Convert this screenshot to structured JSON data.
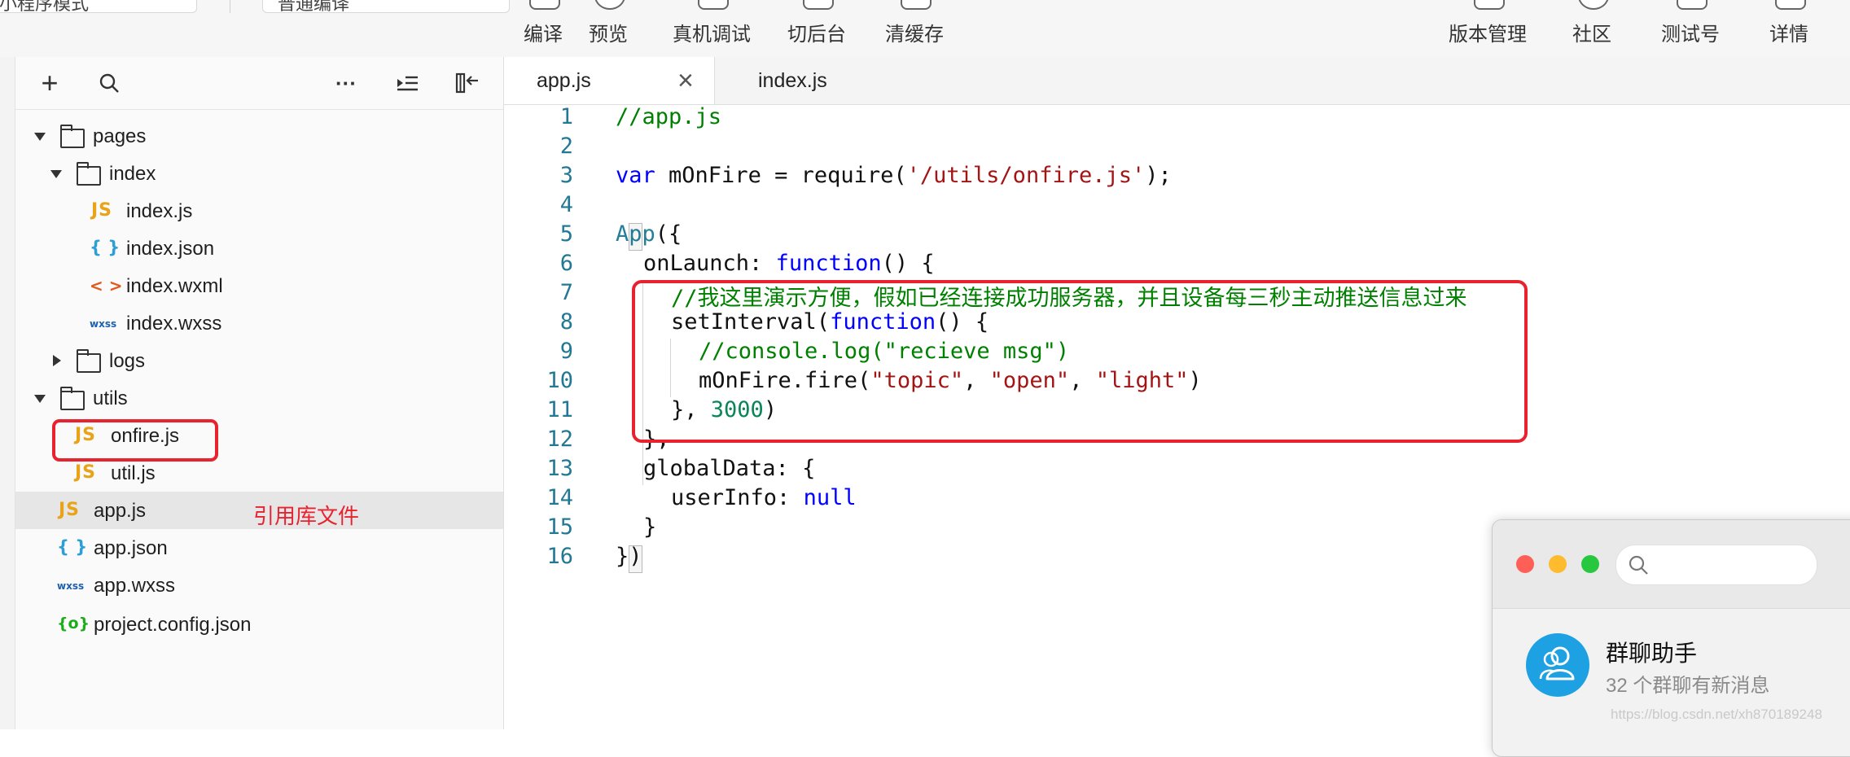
{
  "toolbar": {
    "left_fragment": "小程序模式",
    "mode_fragment": "普通编译",
    "left_actions": [
      "编译",
      "预览",
      "真机调试",
      "切后台",
      "清缓存"
    ],
    "right_actions": [
      "版本管理",
      "社区",
      "测试号",
      "详情"
    ]
  },
  "sidebar": {
    "toolbar_icons": [
      "add-icon",
      "search-icon",
      "more-icon",
      "collapse-all-icon",
      "toggle-panel-icon"
    ],
    "tree": [
      {
        "label": "pages",
        "type": "folder",
        "expanded": true
      },
      {
        "label": "index",
        "type": "folder",
        "expanded": true
      },
      {
        "label": "index.js",
        "type": "js",
        "icon": "JS"
      },
      {
        "label": "index.json",
        "type": "json",
        "icon": "{ }"
      },
      {
        "label": "index.wxml",
        "type": "wxml",
        "icon": "< >"
      },
      {
        "label": "index.wxss",
        "type": "wxss",
        "icon": "wxss"
      },
      {
        "label": "logs",
        "type": "folder",
        "expanded": false
      },
      {
        "label": "utils",
        "type": "folder",
        "expanded": true
      },
      {
        "label": "onfire.js",
        "type": "js",
        "icon": "JS",
        "highlighted": true
      },
      {
        "label": "util.js",
        "type": "js",
        "icon": "JS"
      },
      {
        "label": "app.js",
        "type": "js",
        "icon": "JS",
        "selected": true
      },
      {
        "label": "app.json",
        "type": "json",
        "icon": "{ }"
      },
      {
        "label": "app.wxss",
        "type": "wxss",
        "icon": "wxss"
      },
      {
        "label": "project.config.json",
        "type": "config",
        "icon": "{o}"
      }
    ],
    "annotation": "引用库文件"
  },
  "editor": {
    "tabs": [
      {
        "label": "app.js",
        "active": true,
        "close_glyph": "×"
      },
      {
        "label": "index.js",
        "active": false
      }
    ],
    "line_numbers": [
      "1",
      "2",
      "3",
      "4",
      "5",
      "6",
      "7",
      "8",
      "9",
      "10",
      "11",
      "12",
      "13",
      "14",
      "15",
      "16"
    ],
    "code_tokens": {
      "l1": "//app.js",
      "l3_kw": "var",
      "l3_mid": " mOnFire = require(",
      "l3_str": "'/utils/onfire.js'",
      "l3_end": ");",
      "l5_id": "App",
      "l5_end": "({",
      "l6_a": "onLaunch: ",
      "l6_kw": "function",
      "l6_end": "() {",
      "l7": "//我这里演示方便，假如已经连接成功服务器，并且设备每三秒主动推送信息过来",
      "l8_a": "setInterval(",
      "l8_kw": "function",
      "l8_end": "() {",
      "l9": "//console.log(\"recieve msg\")",
      "l10_a": "mOnFire.fire(",
      "l10_s1": "\"topic\"",
      "l10_c1": ", ",
      "l10_s2": "\"open\"",
      "l10_c2": ", ",
      "l10_s3": "\"light\"",
      "l10_end": ")",
      "l11_a": "}, ",
      "l11_num": "3000",
      "l11_end": ")",
      "l12": "},",
      "l13": "globalData: {",
      "l14_a": "userInfo: ",
      "l14_kw": "null",
      "l15": "}",
      "l16": "})"
    }
  },
  "wechat_popup": {
    "title": "群聊助手",
    "subtitle": "32 个群聊有新消息",
    "traffic_lights": {
      "close": "#fe5f57",
      "minimize": "#febb2e",
      "zoom": "#27c840"
    },
    "avatar_color": "#1da1e2"
  },
  "watermark": "https://blog.csdn.net/xh870189248",
  "colors": {
    "highlight_border": "#e8222e",
    "annotation_text": "#e8222e",
    "comment": "#008000",
    "keyword": "#0000ff",
    "string": "#a31515",
    "number": "#098658",
    "line_number": "#237893"
  }
}
